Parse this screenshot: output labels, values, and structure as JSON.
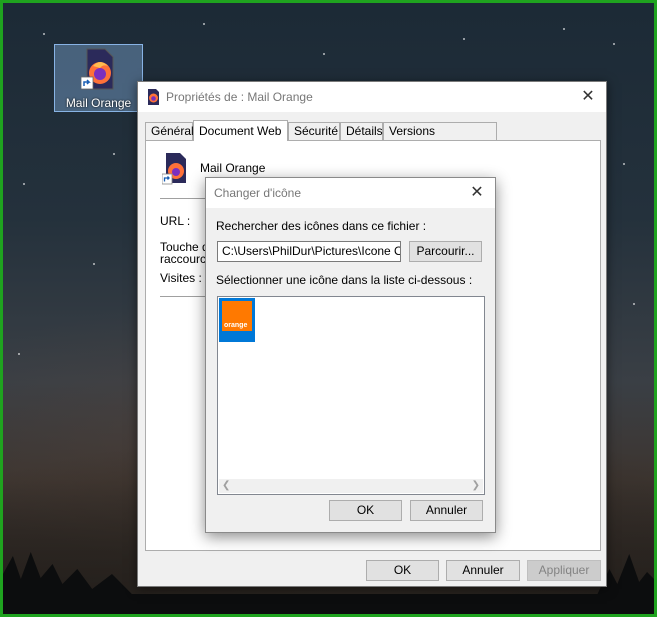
{
  "desktop": {
    "icon_label": "Mail Orange"
  },
  "properties_window": {
    "title": "Propriétés de : Mail Orange",
    "tabs": [
      {
        "label": "Général"
      },
      {
        "label": "Document Web"
      },
      {
        "label": "Sécurité"
      },
      {
        "label": "Détails"
      },
      {
        "label": "Versions précédentes"
      }
    ],
    "active_tab": "Document Web",
    "shortcut_name": "Mail Orange",
    "url_label": "URL :",
    "hotkey_label_line1": "Touche d",
    "hotkey_label_line2": "raccourci",
    "visits_label": "Visites :",
    "buttons": {
      "ok": "OK",
      "cancel": "Annuler",
      "apply": "Appliquer"
    }
  },
  "change_icon_dialog": {
    "title": "Changer d'icône",
    "search_label": "Rechercher des icônes dans ce fichier :",
    "file_path": "C:\\Users\\PhilDur\\Pictures\\Icone Orange",
    "browse_button": "Parcourir...",
    "list_label": "Sélectionner une icône dans la liste ci-dessous :",
    "icon_text": "orange",
    "buttons": {
      "ok": "OK",
      "cancel": "Annuler"
    }
  },
  "colors": {
    "accent_selection": "#0078d7",
    "orange_brand": "#ff7900",
    "desktop_border": "#1fa31f"
  }
}
